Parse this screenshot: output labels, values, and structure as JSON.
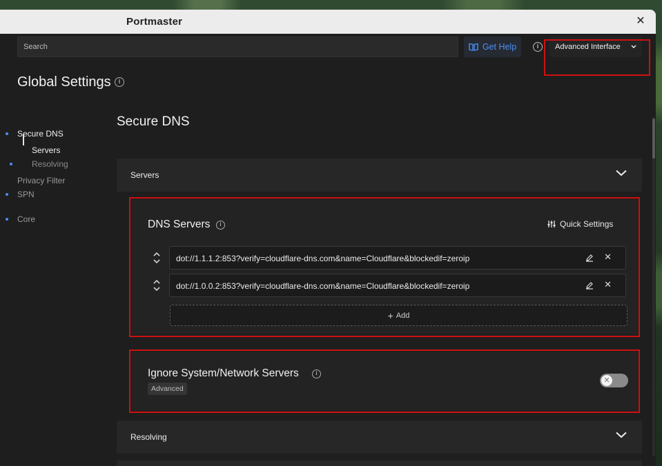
{
  "window": {
    "title": "Portmaster"
  },
  "toolbar": {
    "search_placeholder": "Search",
    "help_label": "Get Help",
    "interface_selected": "Advanced Interface"
  },
  "page": {
    "title": "Global Settings"
  },
  "sidebar": {
    "items": [
      {
        "label": "Secure DNS",
        "level": 0,
        "active": true
      },
      {
        "label": "Servers",
        "level": 1,
        "active": true
      },
      {
        "label": "Resolving",
        "level": 1,
        "active": false
      },
      {
        "label": "Privacy Filter",
        "level": 0,
        "active": false
      },
      {
        "label": "SPN",
        "level": 0,
        "active": false
      },
      {
        "label": "Core",
        "level": 0,
        "active": false
      }
    ]
  },
  "main": {
    "section_title": "Secure DNS",
    "accordions": [
      {
        "label": "Servers",
        "expanded": true
      },
      {
        "label": "Resolving",
        "expanded": false
      }
    ],
    "dns_servers": {
      "title": "DNS Servers",
      "quick_settings_label": "Quick Settings",
      "servers": [
        "dot://1.1.1.2:853?verify=cloudflare-dns.com&name=Cloudflare&blockedif=zeroip",
        "dot://1.0.0.2:853?verify=cloudflare-dns.com&name=Cloudflare&blockedif=zeroip"
      ],
      "add_label": "Add"
    },
    "ignore_system": {
      "title": "Ignore System/Network Servers",
      "badge": "Advanced",
      "enabled": false
    }
  },
  "colors": {
    "accent": "#4d8ff0",
    "highlight_box": "#d01010",
    "background": "#1e1e1e"
  }
}
